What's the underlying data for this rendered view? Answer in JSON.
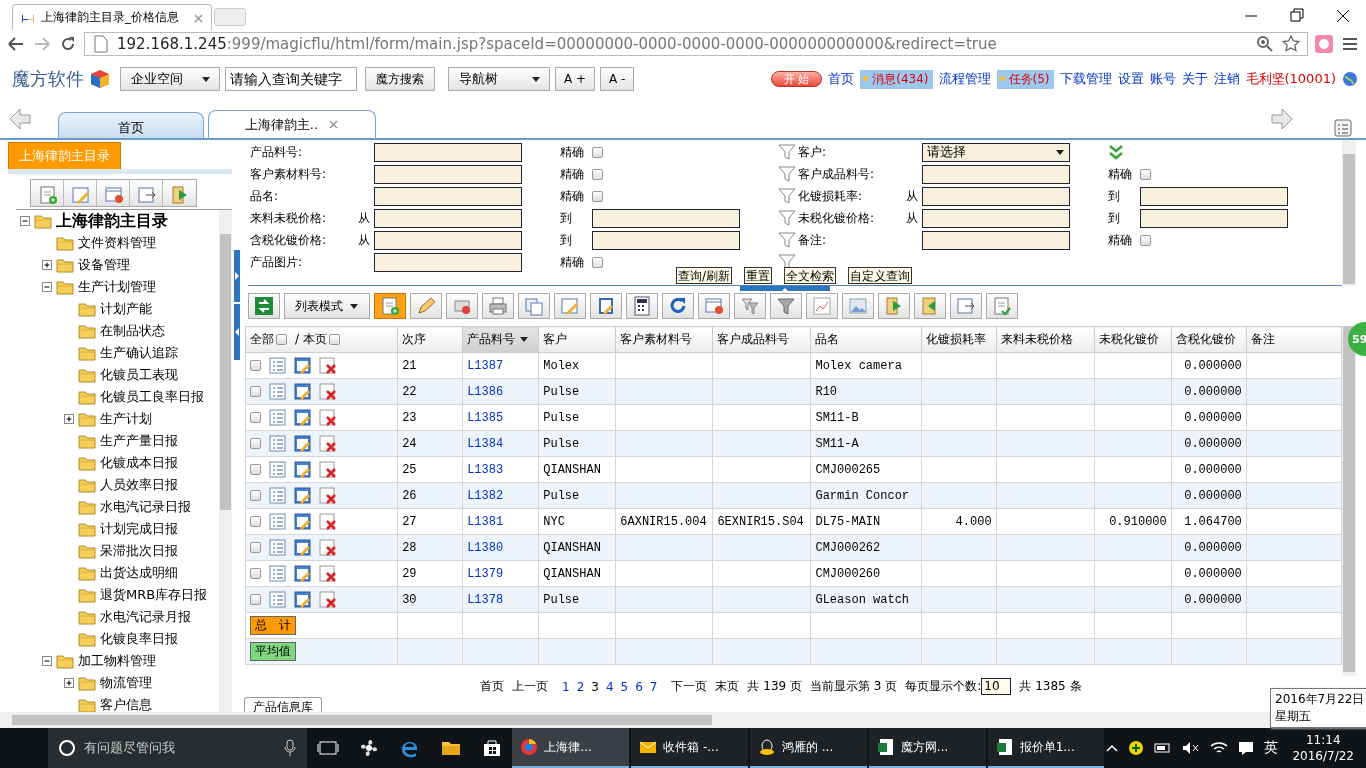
{
  "browser": {
    "tab_title": "上海律韵主目录_价格信息",
    "url_host": "192.168.1.245",
    "url_path": ":999/magicflu/html/form/main.jsp?spaceId=00000000-0000-0000-0000-000000000000&redirect=true"
  },
  "header": {
    "logo": "魔方软件",
    "space_select": "企业空间",
    "search_value": "请输入查询关键字",
    "search_button": "魔方搜索",
    "nav_select": "导航树",
    "font_buttons": [
      "A +",
      "A -"
    ],
    "links": [
      {
        "kind": "start",
        "label": "开 始"
      },
      {
        "kind": "link",
        "label": "首页"
      },
      {
        "kind": "badge",
        "label": "消息(434)"
      },
      {
        "kind": "link",
        "label": "流程管理"
      },
      {
        "kind": "badge",
        "label": "任务(5)"
      },
      {
        "kind": "link",
        "label": "下载管理"
      },
      {
        "kind": "link",
        "label": "设置"
      },
      {
        "kind": "link",
        "label": "账号"
      },
      {
        "kind": "link",
        "label": "关于"
      },
      {
        "kind": "link",
        "label": "注销"
      },
      {
        "kind": "user",
        "label": "毛利坚(10001)"
      }
    ]
  },
  "nav_tabs": [
    {
      "label": "首页",
      "selected": false,
      "closable": false
    },
    {
      "label": "上海律韵主..",
      "selected": true,
      "closable": true
    }
  ],
  "sidebar": {
    "title": "上海律韵主目录",
    "tree": [
      {
        "label": "上海律韵主目录",
        "kind": "group",
        "expanded": true,
        "children": [
          {
            "label": "文件资料管理",
            "kind": "folder"
          },
          {
            "label": "设备管理",
            "kind": "group",
            "expanded": false
          },
          {
            "label": "生产计划管理",
            "kind": "group",
            "expanded": true,
            "children": [
              {
                "label": "计划产能",
                "kind": "folder"
              },
              {
                "label": "在制品状态",
                "kind": "folder"
              },
              {
                "label": "生产确认追踪",
                "kind": "folder"
              },
              {
                "label": "化镀员工表现",
                "kind": "folder"
              },
              {
                "label": "化镀员工良率日报",
                "kind": "folder"
              },
              {
                "label": "生产计划",
                "kind": "group",
                "expanded": false
              },
              {
                "label": "生产产量日报",
                "kind": "folder"
              },
              {
                "label": "化镀成本日报",
                "kind": "folder"
              },
              {
                "label": "人员效率日报",
                "kind": "folder"
              },
              {
                "label": "水电汽记录日报",
                "kind": "folder"
              },
              {
                "label": "计划完成日报",
                "kind": "folder"
              },
              {
                "label": "呆滞批次日报",
                "kind": "folder"
              },
              {
                "label": "出货达成明细",
                "kind": "folder"
              },
              {
                "label": "退货MRB库存日报",
                "kind": "folder"
              },
              {
                "label": "水电汽记录月报",
                "kind": "folder"
              },
              {
                "label": "化镀良率日报",
                "kind": "folder"
              }
            ]
          },
          {
            "label": "加工物料管理",
            "kind": "group",
            "expanded": true,
            "children": [
              {
                "label": "物流管理",
                "kind": "group",
                "expanded": false
              },
              {
                "label": "客户信息",
                "kind": "folder"
              }
            ]
          }
        ]
      }
    ]
  },
  "filter": {
    "left": [
      {
        "kind": "text",
        "label": "产品料号:",
        "exact": "精确",
        "checked": false
      },
      {
        "kind": "text",
        "label": "客户素材料号:",
        "exact": "精确",
        "checked": false
      },
      {
        "kind": "text",
        "label": "品名:",
        "exact": "精确",
        "checked": false
      },
      {
        "kind": "range",
        "label": "来料未税价格:",
        "from": "从",
        "to": "到"
      },
      {
        "kind": "range",
        "label": "含税化镀价格:",
        "from": "从",
        "to": "到"
      },
      {
        "kind": "text",
        "label": "产品图片:",
        "exact": "精确",
        "checked": false
      }
    ],
    "right": [
      {
        "kind": "select",
        "label": "客户:",
        "value": "请选择"
      },
      {
        "kind": "text",
        "label": "客户成品料号:",
        "exact": "精确",
        "checked": false
      },
      {
        "kind": "range",
        "label": "化镀损耗率:",
        "from": "从",
        "to": "到"
      },
      {
        "kind": "range",
        "label": "未税化镀价格:",
        "from": "从",
        "to": "到"
      },
      {
        "kind": "text",
        "label": "备注:",
        "exact": "精确",
        "checked": false
      },
      {
        "kind": "empty"
      }
    ],
    "buttons": [
      "查询/刷新",
      "重置",
      "全文检索",
      "自定义查询"
    ]
  },
  "toolbar": {
    "view_mode": "列表模式"
  },
  "grid": {
    "select_all": "全部",
    "select_all_checked": false,
    "select_page": "/ 本页",
    "select_page_checked": false,
    "columns": [
      {
        "label": "次序",
        "sorted": false
      },
      {
        "label": "产品料号",
        "sorted": true
      },
      {
        "label": "客户",
        "sorted": false
      },
      {
        "label": "客户素材料号",
        "sorted": false
      },
      {
        "label": "客户成品料号",
        "sorted": false
      },
      {
        "label": "品名",
        "sorted": false
      },
      {
        "label": "化镀损耗率",
        "sorted": false
      },
      {
        "label": "来料未税价格",
        "sorted": false
      },
      {
        "label": "未税化镀价",
        "sorted": false
      },
      {
        "label": "含税化镀价",
        "sorted": false
      },
      {
        "label": "备注",
        "sorted": false
      }
    ],
    "rows": [
      {
        "checked": false,
        "seq": "21",
        "part_no": "L1387",
        "customer": "Molex",
        "name": "Molex camera",
        "tax_price": "0.000000"
      },
      {
        "checked": false,
        "seq": "22",
        "part_no": "L1386",
        "customer": "Pulse",
        "name": "R10",
        "tax_price": "0.000000"
      },
      {
        "checked": false,
        "seq": "23",
        "part_no": "L1385",
        "customer": "Pulse",
        "name": "SM11-B",
        "tax_price": "0.000000"
      },
      {
        "checked": false,
        "seq": "24",
        "part_no": "L1384",
        "customer": "Pulse",
        "name": "SM11-A",
        "tax_price": "0.000000"
      },
      {
        "checked": false,
        "seq": "25",
        "part_no": "L1383",
        "customer": "QIANSHAN",
        "name": "CMJ000265",
        "tax_price": "0.000000"
      },
      {
        "checked": false,
        "seq": "26",
        "part_no": "L1382",
        "customer": "Pulse",
        "name": "Garmin Concor",
        "tax_price": "0.000000"
      },
      {
        "checked": false,
        "seq": "27",
        "part_no": "L1381",
        "customer": "NYC",
        "customer_material_no": "6AXNIR15.004",
        "customer_product_no": "6EXNIR15.S04",
        "name": "DL75-MAIN",
        "loss_rate": "4.000",
        "plating_price": "0.910000",
        "tax_price": "1.064700"
      },
      {
        "checked": false,
        "seq": "28",
        "part_no": "L1380",
        "customer": "QIANSHAN",
        "name": "CMJ000262",
        "tax_price": "0.000000"
      },
      {
        "checked": false,
        "seq": "29",
        "part_no": "L1379",
        "customer": "QIANSHAN",
        "name": "CMJ000260",
        "tax_price": "0.000000"
      },
      {
        "checked": false,
        "seq": "30",
        "part_no": "L1378",
        "customer": "Pulse",
        "name": "GLeason watch",
        "tax_price": "0.000000"
      }
    ],
    "summary": [
      {
        "kind": "total",
        "label": "总　计"
      },
      {
        "kind": "average",
        "label": "平均值"
      }
    ]
  },
  "pager": {
    "first": "首页",
    "prev": "上一页",
    "pages": [
      {
        "label": "1",
        "selected": false
      },
      {
        "label": "2",
        "selected": false
      },
      {
        "label": "3",
        "selected": true
      },
      {
        "label": "4",
        "selected": false
      },
      {
        "label": "5",
        "selected": false
      },
      {
        "label": "6",
        "selected": false
      },
      {
        "label": "7",
        "selected": false
      }
    ],
    "next": "下一页",
    "last": "末页",
    "total_pages": "共 139 页",
    "current": "当前显示第 3 页",
    "page_size_label": "每页显示个数:",
    "page_size": "10",
    "total_rows": "共 1385 条"
  },
  "bottom_tab": "产品信息库",
  "notification_badge": "59",
  "date_tooltip": [
    "2016年7月22日",
    "星期五"
  ],
  "taskbar": {
    "search_placeholder": "有问题尽管问我",
    "apps": [
      {
        "label": "上海律...",
        "selected": true
      },
      {
        "label": "收件箱 -...",
        "selected": false
      },
      {
        "label": "鸿雁的 ...",
        "selected": false
      },
      {
        "label": "魔方网...",
        "selected": false
      },
      {
        "label": "报价单1...",
        "selected": false
      }
    ],
    "ime": "英",
    "time": "11:14",
    "date": "2016/7/22"
  }
}
